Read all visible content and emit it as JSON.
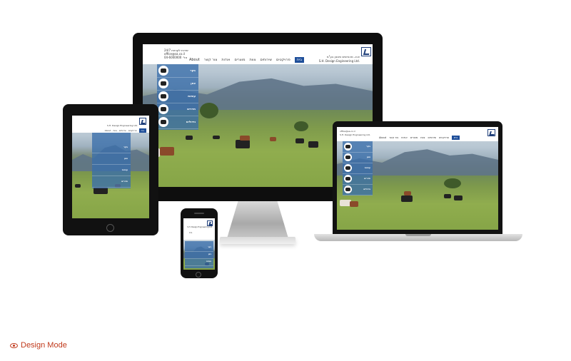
{
  "site": {
    "name_he": "ש.א. מהנדסים ותכנון בע\"מ",
    "name_en": "S.H. Design Engineering Ltd.",
    "contact_lines": [
      "שירות לקוחות 24/7",
      "office@sa.co.il",
      "טל׳ 04-6000000"
    ],
    "nav": [
      "בית",
      "פרויקטים",
      "שירותים",
      "צוות",
      "מוצרים",
      "אודות",
      "צור קשר",
      "About"
    ],
    "active_nav_index": 0,
    "categories": [
      {
        "label": "בקר",
        "icon": "cow-icon"
      },
      {
        "label": "צאן",
        "icon": "sheep-icon"
      },
      {
        "label": "עופות",
        "icon": "chicken-icon"
      },
      {
        "label": "חזירים",
        "icon": "pig-icon"
      },
      {
        "label": "גידולים",
        "icon": "plant-icon"
      }
    ]
  },
  "design_mode": {
    "label": "Design Mode",
    "icon": "eye-icon"
  },
  "colors": {
    "accent": "#1f4f9a",
    "panel": "#3a6eaa",
    "link": "#c0391b"
  }
}
